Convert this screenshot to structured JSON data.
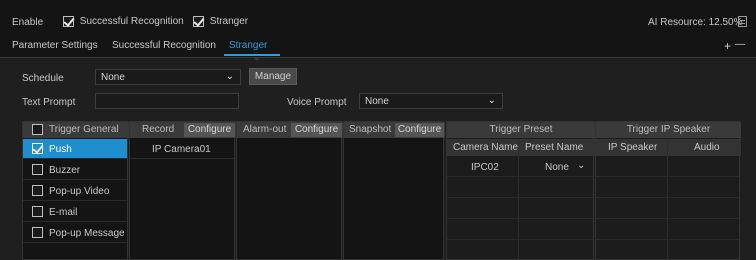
{
  "top": {
    "enable_label": "Enable",
    "successful_recognition": {
      "label": "Successful Recognition",
      "checked": true
    },
    "stranger": {
      "label": "Stranger",
      "checked": true
    },
    "ai_resource": "AI Resource: 12.50%"
  },
  "tabs": [
    {
      "label": "Parameter Settings",
      "active": false
    },
    {
      "label": "Successful Recognition",
      "active": false
    },
    {
      "label": "Stranger",
      "active": true
    }
  ],
  "window_controls": {
    "add": "+",
    "remove": "—"
  },
  "form": {
    "schedule_label": "Schedule",
    "schedule_value": "None",
    "manage_label": "Manage",
    "text_prompt_label": "Text Prompt",
    "text_prompt_value": "",
    "voice_prompt_label": "Voice Prompt",
    "voice_prompt_value": "None"
  },
  "trigger_general": {
    "header": "Trigger General",
    "items": [
      {
        "label": "Push",
        "checked": true,
        "selected": true
      },
      {
        "label": "Buzzer",
        "checked": false
      },
      {
        "label": "Pop-up Video",
        "checked": false
      },
      {
        "label": "E-mail",
        "checked": false
      },
      {
        "label": "Pop-up Message E",
        "checked": false
      }
    ]
  },
  "record": {
    "header": "Record",
    "configure": "Configure",
    "rows": [
      "IP Camera01"
    ]
  },
  "alarm_out": {
    "header": "Alarm-out",
    "configure": "Configure"
  },
  "snapshot": {
    "header": "Snapshot",
    "configure": "Configure"
  },
  "trigger_preset": {
    "header": "Trigger Preset",
    "col_camera": "Camera Name",
    "col_preset": "Preset Name",
    "rows": [
      {
        "camera": "IPC02",
        "preset": "None"
      }
    ]
  },
  "trigger_ip_speaker": {
    "header": "Trigger IP Speaker",
    "col_speaker": "IP Speaker",
    "col_audio": "Audio"
  },
  "colors": {
    "accent": "#2f9cd9",
    "selected_row": "#1f8ecf"
  }
}
